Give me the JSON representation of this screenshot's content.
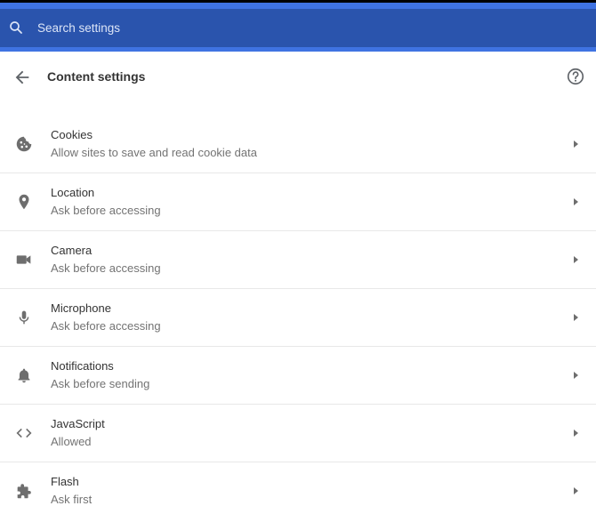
{
  "search": {
    "placeholder": "Search settings"
  },
  "header": {
    "title": "Content settings"
  },
  "colors": {
    "search_band": "#3f73e2",
    "search_bar": "#2a54ad",
    "icon_gray": "#6e6e6e"
  },
  "items": [
    {
      "icon": "cookie-icon",
      "title": "Cookies",
      "subtitle": "Allow sites to save and read cookie data"
    },
    {
      "icon": "location-pin-icon",
      "title": "Location",
      "subtitle": "Ask before accessing"
    },
    {
      "icon": "camera-icon",
      "title": "Camera",
      "subtitle": "Ask before accessing"
    },
    {
      "icon": "microphone-icon",
      "title": "Microphone",
      "subtitle": "Ask before accessing"
    },
    {
      "icon": "bell-icon",
      "title": "Notifications",
      "subtitle": "Ask before sending"
    },
    {
      "icon": "code-brackets-icon",
      "title": "JavaScript",
      "subtitle": "Allowed"
    },
    {
      "icon": "puzzle-piece-icon",
      "title": "Flash",
      "subtitle": "Ask first"
    }
  ]
}
